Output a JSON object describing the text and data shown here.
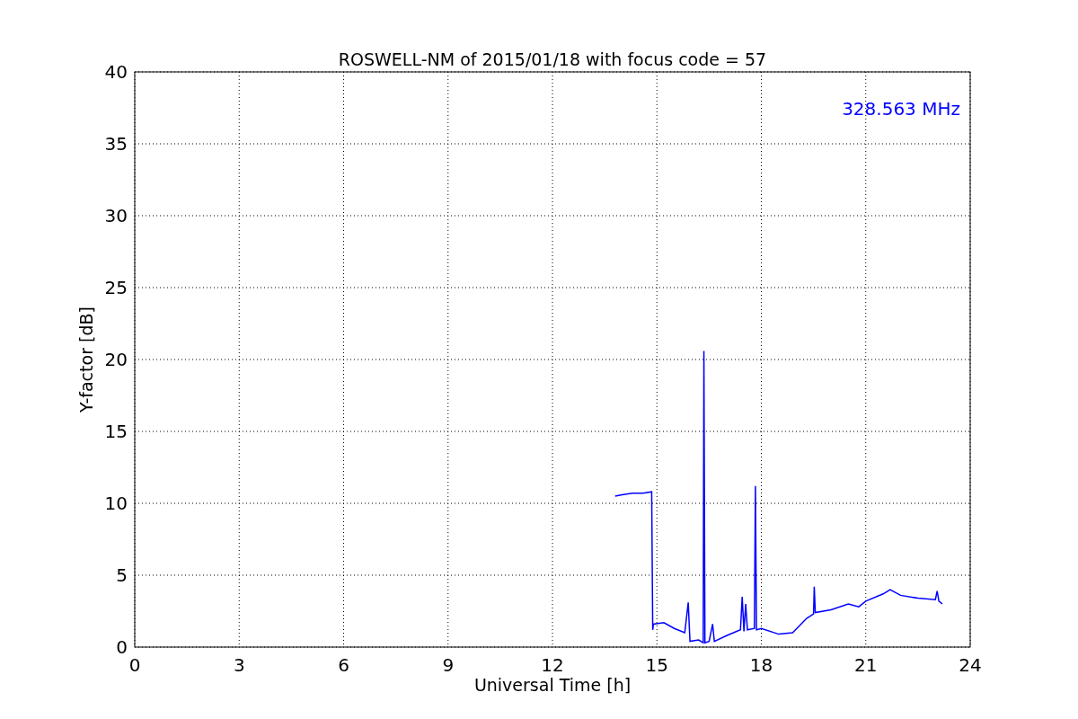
{
  "figure": {
    "chart_data": {
      "type": "line",
      "title": "ROSWELL-NM of 2015/01/18 with focus code = 57",
      "xlabel": "Universal Time [h]",
      "ylabel": "Y-factor [dB]",
      "x": [
        13.8,
        14.0,
        14.3,
        14.6,
        14.85,
        14.88,
        14.9,
        15.2,
        15.5,
        15.8,
        15.9,
        15.95,
        16.2,
        16.33,
        16.35,
        16.38,
        16.5,
        16.6,
        16.65,
        17.0,
        17.4,
        17.45,
        17.5,
        17.55,
        17.6,
        17.8,
        17.83,
        17.86,
        18.0,
        18.5,
        18.9,
        19.3,
        19.5,
        19.52,
        19.55,
        20.0,
        20.5,
        20.8,
        21.0,
        21.5,
        21.7,
        22.0,
        22.5,
        23.0,
        23.05,
        23.1,
        23.2
      ],
      "series": [
        {
          "color": "#0000ff",
          "values": [
            10.5,
            10.6,
            10.7,
            10.7,
            10.8,
            1.2,
            1.6,
            1.7,
            1.3,
            1.0,
            3.1,
            0.4,
            0.5,
            0.3,
            20.6,
            0.3,
            0.4,
            1.6,
            0.4,
            0.8,
            1.2,
            3.5,
            1.1,
            3.0,
            1.2,
            1.3,
            11.2,
            1.2,
            1.3,
            0.9,
            1.0,
            2.0,
            2.3,
            4.2,
            2.4,
            2.6,
            3.0,
            2.8,
            3.2,
            3.7,
            4.0,
            3.6,
            3.4,
            3.3,
            3.9,
            3.2,
            3.0
          ]
        }
      ],
      "xlim": [
        0,
        24
      ],
      "ylim": [
        0,
        40
      ],
      "xticks": [
        0,
        3,
        6,
        9,
        12,
        15,
        18,
        21,
        24
      ],
      "yticks": [
        0,
        5,
        10,
        15,
        20,
        25,
        30,
        35,
        40
      ],
      "grid": true,
      "annotations": [
        {
          "text": "328.563 MHz"
        }
      ]
    }
  }
}
